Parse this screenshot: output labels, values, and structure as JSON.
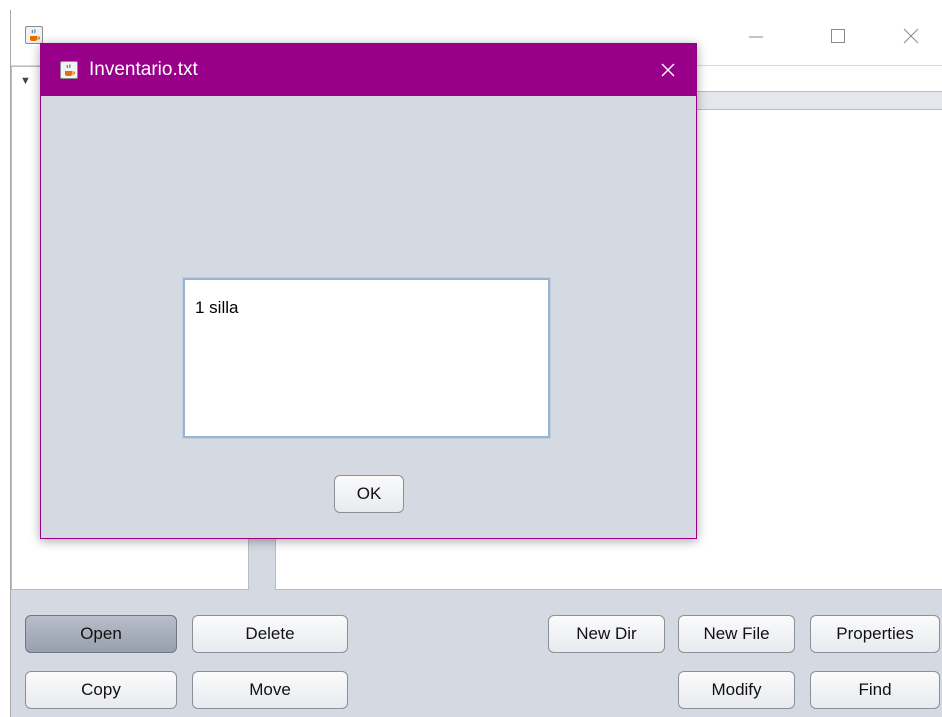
{
  "main_window": {
    "tree_arrow": "▼"
  },
  "buttons": {
    "open": "Open",
    "delete": "Delete",
    "copy": "Copy",
    "move": "Move",
    "new_dir": "New Dir",
    "new_file": "New File",
    "properties": "Properties",
    "modify": "Modify",
    "find": "Find"
  },
  "dialog": {
    "title": "Inventario.txt",
    "content": "1 silla",
    "ok_label": "OK"
  },
  "colors": {
    "dialog_titlebar": "#98008a",
    "window_bg": "#d5d9e1",
    "pressed_button": "#a8afbc"
  },
  "icons": {
    "app": "java-coffee-icon",
    "minimize": "minimize-icon",
    "maximize": "maximize-icon",
    "close": "close-icon"
  }
}
